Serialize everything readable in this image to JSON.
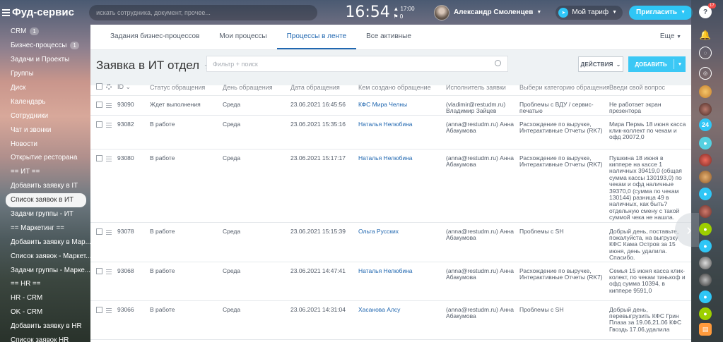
{
  "app": {
    "title": "Фуд-сервис",
    "search_placeholder": "искать сотрудника, документ, прочее...",
    "clock": "16:54",
    "alarm": "17:00",
    "tasks_count": "0"
  },
  "user": {
    "name": "Александр Смоленцев"
  },
  "header": {
    "tariff": "Мой тариф",
    "invite": "Пригласить"
  },
  "sidebar": {
    "items": [
      {
        "label": "CRM",
        "count": "1"
      },
      {
        "label": "Бизнес-процессы",
        "count": "1"
      },
      {
        "label": "Задачи и Проекты"
      },
      {
        "label": "Группы"
      },
      {
        "label": "Диск"
      },
      {
        "label": "Календарь"
      },
      {
        "label": "Сотрудники"
      },
      {
        "label": "Чат и звонки"
      },
      {
        "label": "Новости"
      },
      {
        "label": "Открытие ресторана"
      },
      {
        "label": "== ИТ =="
      },
      {
        "label": "Добавить заявку в IT"
      },
      {
        "label": "Список заявок в ИТ",
        "active": true
      },
      {
        "label": "Задачи группы - ИТ"
      },
      {
        "label": "== Маркетинг =="
      },
      {
        "label": "Добавить заявку в Мар..."
      },
      {
        "label": "Список заявок - Маркет..."
      },
      {
        "label": "Задачи группы - Марке..."
      },
      {
        "label": "== HR =="
      },
      {
        "label": "HR - CRM"
      },
      {
        "label": "OK - CRM"
      },
      {
        "label": "Добавить заявку в HR"
      },
      {
        "label": "Список заявок HR"
      }
    ]
  },
  "tabs": [
    "Задания бизнес-процессов",
    "Мои процессы",
    "Процессы в ленте",
    "Все активные"
  ],
  "more_label": "Еще",
  "page": {
    "title": "Заявка в ИТ отдел",
    "filter_placeholder": "Фильтр + поиск",
    "actions_label": "ДЕЙСТВИЯ",
    "add_label": "ДОБАВИТЬ"
  },
  "table": {
    "columns": [
      "ID",
      "Статус обращения",
      "День обращения",
      "Дата обращения",
      "Кем создано обращение",
      "Исполнитель заявки",
      "Выбери категорию обращения",
      "Введи свой вопрос"
    ],
    "rows": [
      {
        "id": "93090",
        "status": "Ждет выполнения",
        "day": "Среда",
        "date": "23.06.2021 16:45:56",
        "creator": "КФС Мира Челны",
        "executor": "(vladimir@restudm.ru) Владимир Зайцев",
        "category": "Проблемы с ВДУ / сервис-печатью",
        "question": "Не работает экран презентора"
      },
      {
        "id": "93082",
        "status": "В работе",
        "day": "Среда",
        "date": "23.06.2021 15:35:16",
        "creator": "Наталья Нелюбина",
        "executor": "(anna@restudm.ru) Анна Абакумова",
        "category": "Расхождение по выручке, Интерактивные Отчеты (RK7)",
        "question": "Мира Пермь 18 июня касса клик-коллект по чекам и офд 20072,0"
      },
      {
        "id": "93080",
        "status": "В работе",
        "day": "Среда",
        "date": "23.06.2021 15:17:17",
        "creator": "Наталья Нелюбина",
        "executor": "(anna@restudm.ru) Анна Абакумова",
        "category": "Расхождение по выручке, Интерактивные Отчеты (RK7)",
        "question": "Пушкина 18 июня в киппере на кассе 1 наличных 39419,0 (общая сумма кассы 130193,0) по чекам и офд наличные 39370,0 (сумма по чекам 130144) разница 49 в наличных, как быть? отдельную смену с такой суммой чека не нашла."
      },
      {
        "id": "93078",
        "status": "В работе",
        "day": "Среда",
        "date": "23.06.2021 15:15:39",
        "creator": "Ольга Русских",
        "executor": "(anna@restudm.ru) Анна Абакумова",
        "category": "Проблемы с SH",
        "question": "Добрый день, поставьте, пожалуйста, на выгрузку КФС Кама Остров за 15 июня, день удалила. Спасибо."
      },
      {
        "id": "93068",
        "status": "В работе",
        "day": "Среда",
        "date": "23.06.2021 14:47:41",
        "creator": "Наталья Нелюбина",
        "executor": "(anna@restudm.ru) Анна Абакумова",
        "category": "Расхождение по выручке, Интерактивные Отчеты (RK7)",
        "question": "Семья 15 июня касса клик-колект, по чекам тинькоф и офд сумма 10394, в киппере 9591,0"
      },
      {
        "id": "93066",
        "status": "В работе",
        "day": "Среда",
        "date": "23.06.2021 14:31:04",
        "creator": "Хасанова Алсу",
        "executor": "(anna@restudm.ru) Анна Абакумова",
        "category": "Проблемы с SH",
        "question": "Добрый день, перевыгрузить КФС Грин Плаза за 19.06,21.06 КФС Гвоздь 17.06,удалила"
      }
    ]
  },
  "right_panel": {
    "help": "?",
    "notifications": "17",
    "counter": "24"
  },
  "colors": {
    "accent": "#2fc6f6",
    "link": "#2067b0"
  }
}
